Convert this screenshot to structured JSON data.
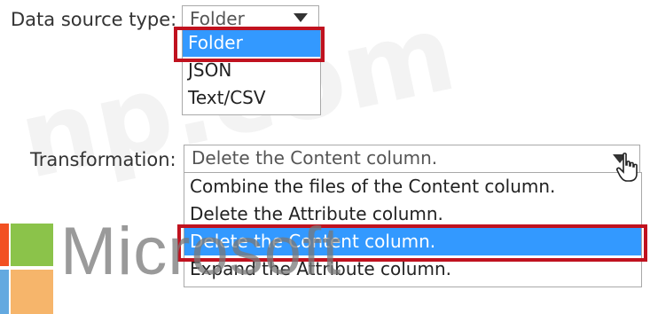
{
  "data_source": {
    "label": "Data source type:",
    "selected_value": "Folder",
    "options": [
      "Folder",
      "JSON",
      "Text/CSV"
    ],
    "highlighted_option": "Folder"
  },
  "transformation": {
    "label": "Transformation:",
    "selected_value": "Delete the Content column.",
    "options": [
      "Combine the files of the Content column.",
      "Delete the Attribute column.",
      "Delete the Content column.",
      "Expand the Attribute column."
    ],
    "highlighted_option": "Delete the Content column."
  },
  "watermark": "np.com",
  "logo": {
    "text": "Microsoft",
    "colors": {
      "green": "#8bc34a",
      "blue": "#63a9e0",
      "orange": "#f6b56b",
      "red": "#f25022"
    }
  },
  "colors": {
    "selection": "#3399ff",
    "highlight_border": "#c0121f"
  }
}
